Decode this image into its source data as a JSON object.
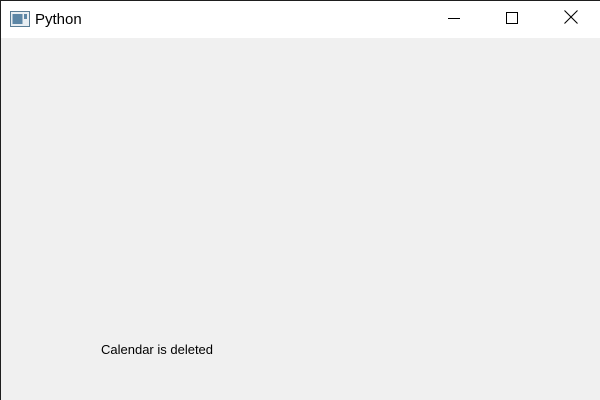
{
  "window": {
    "title": "Python",
    "icons": {
      "app": "python-window-icon",
      "minimize": "minimize-icon",
      "maximize": "maximize-icon",
      "close": "close-icon"
    }
  },
  "content": {
    "status_label": "Calendar is deleted"
  },
  "colors": {
    "titlebar": "#ffffff",
    "client_area": "#f0f0f0",
    "text": "#000000"
  }
}
